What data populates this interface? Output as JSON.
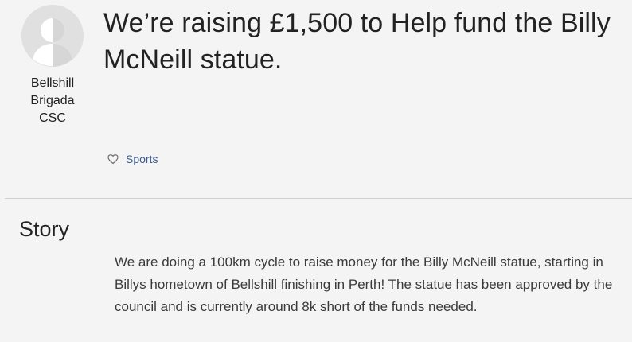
{
  "organizer": {
    "avatar_icon": "user-avatar-icon",
    "name_lines": [
      "Bellshill",
      "Brigada",
      "CSC"
    ]
  },
  "campaign": {
    "title_line1": "We’re raising £1,500 to Help fund the Billy",
    "title_line2": "McNeill statue.",
    "category_icon": "heart-icon",
    "category_label": "Sports"
  },
  "story": {
    "heading": "Story",
    "body": "We are doing a 100km cycle to raise money for the Billy McNeill statue, starting in Billys hometown of Bellshill finishing in Perth! The statue has been approved by the council and is currently around 8k short of the funds needed."
  },
  "colors": {
    "background": "#f4f4f4",
    "link": "#3b5b8f",
    "divider": "#cfcfcf"
  }
}
